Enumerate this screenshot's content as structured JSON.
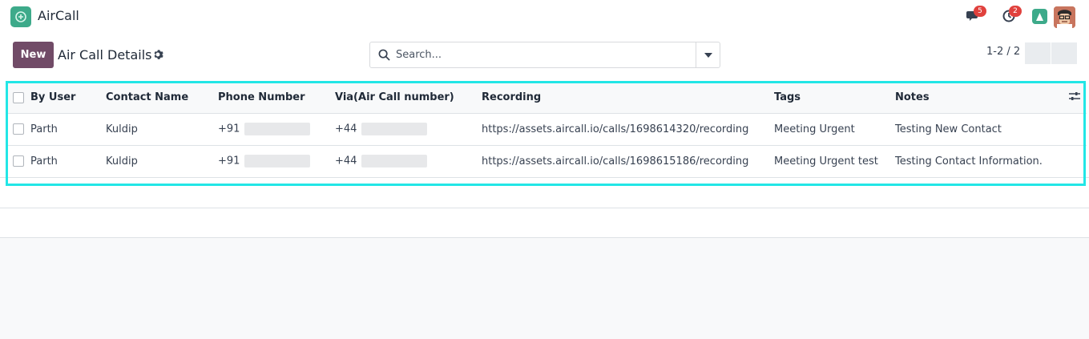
{
  "app": {
    "name": "AirCall"
  },
  "systray": {
    "messages_badge": "5",
    "activities_badge": "2"
  },
  "control_panel": {
    "new_label": "New",
    "title": "Air Call Details",
    "search_placeholder": "Search...",
    "pager": "1-2 / 2"
  },
  "table": {
    "headers": {
      "by_user": "By User",
      "contact_name": "Contact Name",
      "phone_number": "Phone Number",
      "via": "Via(Air Call number)",
      "recording": "Recording",
      "tags": "Tags",
      "notes": "Notes"
    },
    "rows": [
      {
        "by_user": "Parth",
        "contact_name": "Kuldip",
        "phone_prefix": "+91",
        "via_prefix": "+44",
        "recording": "https://assets.aircall.io/calls/1698614320/recording",
        "tags": "Meeting Urgent",
        "notes": "Testing New Contact"
      },
      {
        "by_user": "Parth",
        "contact_name": "Kuldip",
        "phone_prefix": "+91",
        "via_prefix": "+44",
        "recording": "https://assets.aircall.io/calls/1698615186/recording",
        "tags": "Meeting Urgent test",
        "notes": "Testing Contact Information."
      }
    ]
  },
  "colors": {
    "brand": "#714b67",
    "highlight": "#22e6e6",
    "badge": "#e0413d",
    "app_logo": "#3daa8a"
  }
}
